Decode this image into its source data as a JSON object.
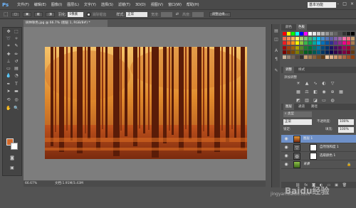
{
  "app": {
    "logo": "Ps"
  },
  "menu": [
    "文件(F)",
    "编辑(E)",
    "图像(I)",
    "图层(L)",
    "文字(Y)",
    "选择(S)",
    "滤镜(T)",
    "3D(D)",
    "视图(V)",
    "窗口(W)",
    "帮助(H)"
  ],
  "workspace": "基本功能",
  "options": {
    "feather_label": "羽化:",
    "feather_value": "0像素",
    "antialias_label": "消除锯齿",
    "style_label": "样式:",
    "style_value": "正常",
    "width_label": "宽度:",
    "height_label": "高度:",
    "refine_edge": "调整边缘..."
  },
  "document": {
    "tab_title": "树林秋色.jpg @ 66.7% (图层 1, RGB/8#) *",
    "zoom": "66.67%",
    "doc_info": "文档:1.91M/3.43M"
  },
  "panels": {
    "color_tabs": [
      "颜色",
      "色板"
    ],
    "adjust_tabs": [
      "调整",
      "样式"
    ],
    "adjust_title": "添加调整",
    "layer_tabs": [
      "图层",
      "通道",
      "路径"
    ],
    "kind_label": "类型",
    "blend_mode": "正常",
    "opacity_label": "不透明度:",
    "opacity_value": "100%",
    "lock_label": "锁定:",
    "fill_label": "填充:",
    "fill_value": "100%"
  },
  "layers": [
    {
      "name": "图层 1",
      "selected": true,
      "thumb": "forest"
    },
    {
      "name": "自然饱和度 1",
      "selected": false,
      "thumb": "white"
    },
    {
      "name": "选取颜色 1",
      "selected": false,
      "thumb": "white"
    },
    {
      "name": "背景",
      "selected": false,
      "thumb": "forest"
    }
  ],
  "watermark": {
    "logo": "Baidu经验",
    "url": "jingyan.baidu.com"
  },
  "colors": {
    "foreground": "#d2692b",
    "background": "#ffffff"
  }
}
